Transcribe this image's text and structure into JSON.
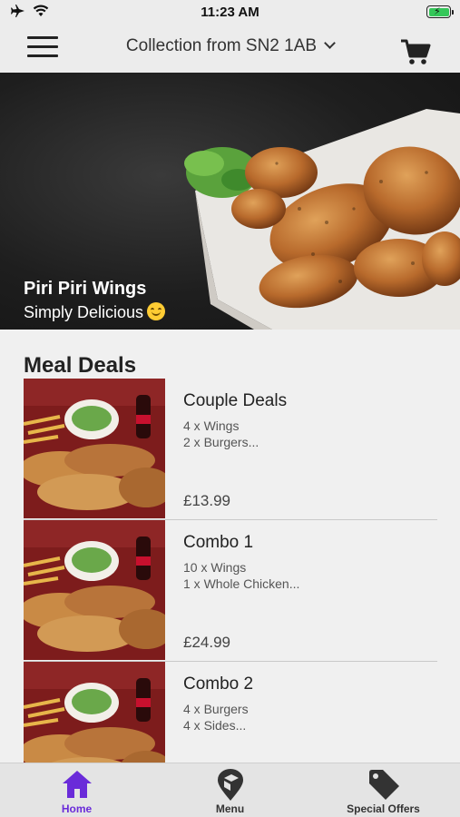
{
  "status_bar": {
    "time": "11:23 AM"
  },
  "header": {
    "location": "Collection from SN2 1AB"
  },
  "hero": {
    "title": "Piri Piri Wings",
    "subtitle": "Simply Delicious"
  },
  "section_title": "Meal Deals",
  "deals": [
    {
      "name": "Couple Deals",
      "line1": "4 x Wings",
      "line2": "2 x Burgers...",
      "price": "£13.99"
    },
    {
      "name": "Combo 1",
      "line1": "10 x Wings",
      "line2": "1 x Whole Chicken...",
      "price": "£24.99"
    },
    {
      "name": "Combo 2",
      "line1": "4 x Burgers",
      "line2": "4 x Sides...",
      "price": ""
    }
  ],
  "tabs": [
    {
      "label": "Home",
      "icon": "home-icon",
      "active": true
    },
    {
      "label": "Menu",
      "icon": "map-pin-icon",
      "active": false
    },
    {
      "label": "Special Offers",
      "icon": "tag-icon",
      "active": false
    }
  ],
  "colors": {
    "accent": "#6a2bd9",
    "battery": "#34c759"
  }
}
